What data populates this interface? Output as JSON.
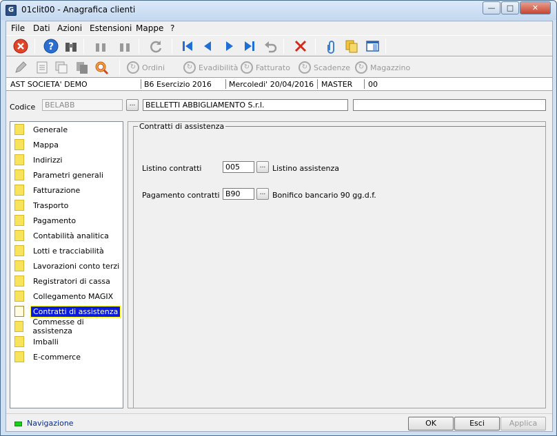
{
  "window": {
    "title": "01clit00 - Anagrafica clienti",
    "app_icon": "G",
    "min": "—",
    "max": "□",
    "close": "✕"
  },
  "menu": [
    "File",
    "Dati",
    "Azioni",
    "Estensioni",
    "Mappe",
    "?"
  ],
  "toolbar2_links": [
    "Ordini",
    "Evadibilità",
    "Fatturato",
    "Scadenze",
    "Magazzino"
  ],
  "info": {
    "company": "AST SOCIETA' DEMO",
    "exercise": "B6 Esercizio 2016",
    "date": "Mercoledi' 20/04/2016",
    "user": "MASTER",
    "code": "00"
  },
  "codice": {
    "label": "Codice",
    "value": "BELABB",
    "btn": "...",
    "name": "BELLETTI ABBIGLIAMENTO S.r.l.",
    "extra": ""
  },
  "tree": [
    "Generale",
    "Mappa",
    "Indirizzi",
    "Parametri generali",
    "Fatturazione",
    "Trasporto",
    "Pagamento",
    "Contabilità analitica",
    "Lotti e tracciabilità",
    "Lavorazioni conto terzi",
    "Registratori di cassa",
    "Collegamento MAGIX",
    "Contratti di assistenza",
    "Commesse di assistenza",
    "Imballi",
    "E-commerce"
  ],
  "tree_selected": "Contratti di assistenza",
  "group": {
    "title": "Contratti di assistenza",
    "listino": {
      "label": "Listino contratti",
      "value": "005",
      "btn": "...",
      "desc": "Listino assistenza"
    },
    "pagamento": {
      "label": "Pagamento contratti",
      "value": "B90",
      "btn": "...",
      "desc": "Bonifico bancario 90 gg.d.f."
    }
  },
  "status": {
    "nav": "Navigazione",
    "ok": "OK",
    "esci": "Esci",
    "applica": "Applica"
  },
  "colors": {
    "selection": "#0a1bd9",
    "led": "#17d117",
    "folder": "#f8e35c"
  }
}
